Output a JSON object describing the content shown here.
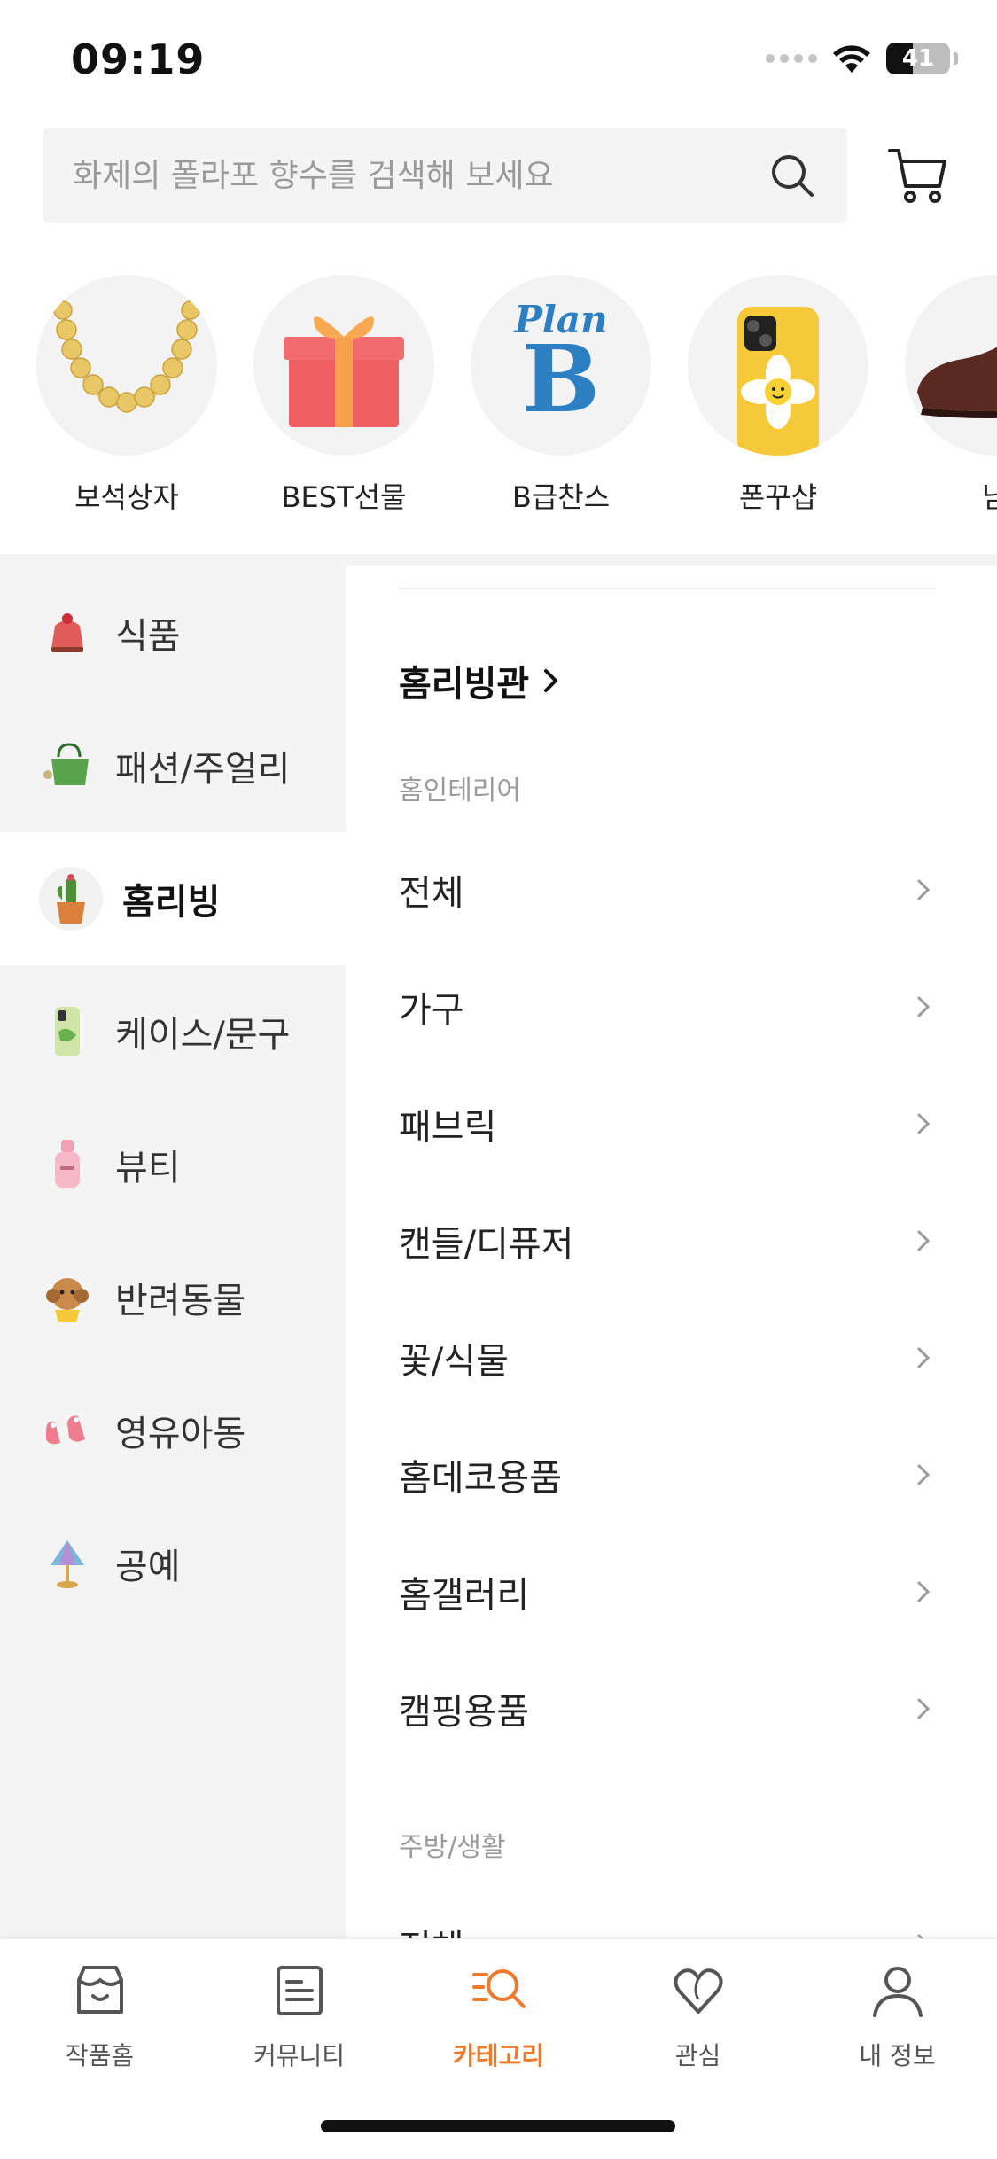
{
  "status": {
    "time": "09:19",
    "battery": "41",
    "battery_level": 0.41
  },
  "search": {
    "placeholder": "화제의 폴라포 향수를 검색해 보세요"
  },
  "quick_categories": [
    {
      "label": "보석상자",
      "icon": "necklace-image"
    },
    {
      "label": "BEST선물",
      "icon": "gift-box-image"
    },
    {
      "label": "B급찬스",
      "icon": "plan-b-logo",
      "logo_text_top": "Plan",
      "logo_text_main": "B"
    },
    {
      "label": "폰꾸샵",
      "icon": "phone-case-image"
    },
    {
      "label": "남",
      "icon": "shoe-image"
    }
  ],
  "rail": {
    "items": [
      {
        "label": "식품",
        "icon": "cake-icon"
      },
      {
        "label": "패션/주얼리",
        "icon": "bag-icon"
      },
      {
        "label": "홈리빙",
        "icon": "cactus-pot-icon",
        "active": true
      },
      {
        "label": "케이스/문구",
        "icon": "phone-case-icon"
      },
      {
        "label": "뷰티",
        "icon": "perfume-icon"
      },
      {
        "label": "반려동물",
        "icon": "puppy-icon"
      },
      {
        "label": "영유아동",
        "icon": "baby-shoes-icon"
      },
      {
        "label": "공예",
        "icon": "lamp-icon"
      }
    ]
  },
  "panel": {
    "title": "홈리빙관",
    "sections": [
      {
        "label": "홈인테리어",
        "items": [
          "전체",
          "가구",
          "패브릭",
          "캔들/디퓨저",
          "꽃/식물",
          "홈데코용품",
          "홈갤러리",
          "캠핑용품"
        ]
      },
      {
        "label": "주방/생활",
        "items": [
          "전체"
        ]
      }
    ]
  },
  "tabs": [
    {
      "label": "작품홈",
      "icon": "shop-icon"
    },
    {
      "label": "커뮤니티",
      "icon": "board-icon"
    },
    {
      "label": "카테고리",
      "icon": "category-search-icon",
      "active": true
    },
    {
      "label": "관심",
      "icon": "heart-icon"
    },
    {
      "label": "내 정보",
      "icon": "person-icon"
    }
  ],
  "colors": {
    "accent": "#f07a2c",
    "rail_bg": "#f4f4f4",
    "text": "#222222",
    "muted": "#9a9a9a"
  }
}
